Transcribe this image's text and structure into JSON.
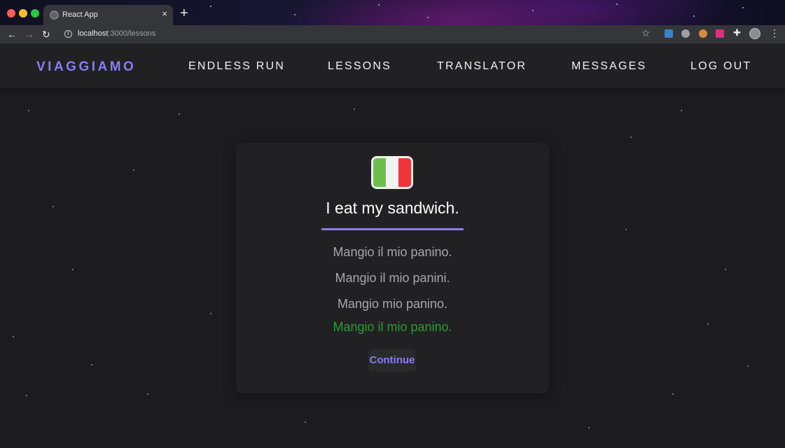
{
  "browser": {
    "tab_title": "React App",
    "tab_close": "×",
    "new_tab": "+",
    "back": "←",
    "forward": "→",
    "reload": "↻",
    "url_host": "localhost",
    "url_rest": ":3000/lessons",
    "bookmark": "☆",
    "menu": "⋮",
    "extension_icon": "✚"
  },
  "navbar": {
    "brand": "VIAGGIAMO",
    "links": [
      "ENDLESS RUN",
      "LESSONS",
      "TRANSLATOR",
      "MESSAGES",
      "LOG OUT"
    ]
  },
  "lesson": {
    "flag_icon": "italy-flag-icon",
    "prompt": "I eat my sandwich.",
    "options": [
      "Mangio il mio panino.",
      "Mangio il mio panini.",
      "Mangio mio panino.",
      "Mangio il mio panino."
    ],
    "correct_answer": "Mangio il mio panino.",
    "continue_label": "Continue"
  },
  "colors": {
    "accent": "#8b7cf6",
    "correct": "#2e9a2e",
    "background": "#1c1c1e",
    "card": "#212123"
  }
}
